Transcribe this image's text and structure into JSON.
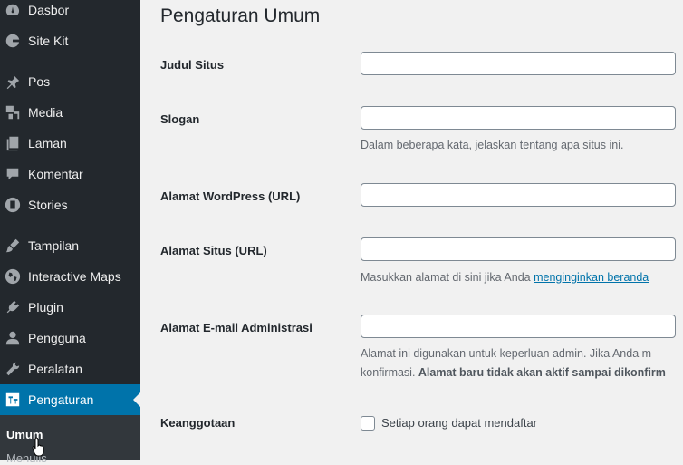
{
  "sidebar": {
    "items": [
      {
        "label": "Dasbor",
        "icon": "dashboard-icon"
      },
      {
        "label": "Site Kit",
        "icon": "google-g-icon"
      },
      {
        "label": "Pos",
        "icon": "pushpin-icon"
      },
      {
        "label": "Media",
        "icon": "media-icon"
      },
      {
        "label": "Laman",
        "icon": "pages-icon"
      },
      {
        "label": "Komentar",
        "icon": "comment-icon"
      },
      {
        "label": "Stories",
        "icon": "stories-icon"
      },
      {
        "label": "Tampilan",
        "icon": "paintbrush-icon"
      },
      {
        "label": "Interactive Maps",
        "icon": "globe-icon"
      },
      {
        "label": "Plugin",
        "icon": "plugin-icon"
      },
      {
        "label": "Pengguna",
        "icon": "user-icon"
      },
      {
        "label": "Peralatan",
        "icon": "wrench-icon"
      },
      {
        "label": "Pengaturan",
        "icon": "settings-icon",
        "active": true
      }
    ],
    "submenu": [
      {
        "label": "Umum",
        "current": true
      },
      {
        "label": "Menulis"
      }
    ]
  },
  "main": {
    "title": "Pengaturan Umum",
    "fields": [
      {
        "label": "Judul Situs",
        "value": ""
      },
      {
        "label": "Slogan",
        "value": "",
        "description": "Dalam beberapa kata, jelaskan tentang apa situs ini."
      },
      {
        "label": "Alamat WordPress (URL)",
        "value": ""
      },
      {
        "label": "Alamat Situs (URL)",
        "value": "",
        "description_prefix": "Masukkan alamat di sini jika Anda ",
        "description_link": "menginginkan beranda"
      },
      {
        "label": "Alamat E-mail Administrasi",
        "value": "",
        "description_line1": "Alamat ini digunakan untuk keperluan admin. Jika Anda m",
        "description_line2_prefix": "konfirmasi. ",
        "description_line2_bold": "Alamat baru tidak akan aktif sampai dikonfirm"
      }
    ],
    "membership": {
      "label": "Keanggotaan",
      "checkbox_label": "Setiap orang dapat mendaftar",
      "checked": false
    }
  }
}
